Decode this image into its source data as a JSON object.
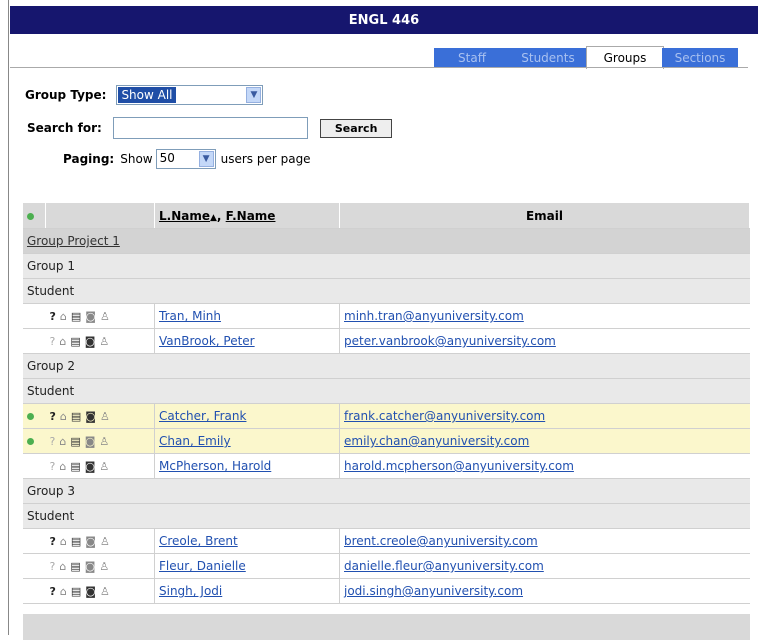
{
  "title": "ENGL 446",
  "tabs": [
    {
      "label": "Staff",
      "active": false
    },
    {
      "label": "Students",
      "active": false
    },
    {
      "label": "Groups",
      "active": true
    },
    {
      "label": "Sections",
      "active": false
    }
  ],
  "form": {
    "group_type_label": "Group Type:",
    "group_type_value": "Show All",
    "search_label": "Search for:",
    "search_value": "",
    "search_button": "Search",
    "paging_label": "Paging:",
    "paging_show": "Show",
    "paging_value": "50",
    "paging_suffix": "users per page"
  },
  "table": {
    "col_name_last": "L.Name",
    "col_sort_indicator": "▲",
    "col_name_sep": ",",
    "col_name_first": "F.Name",
    "col_email": "Email",
    "project": "Group Project 1",
    "groups": [
      {
        "name": "Group 1",
        "role": "Student",
        "members": [
          {
            "name": "Tran, Minh",
            "email": "minh.tran@anyuniversity.com",
            "dot": false,
            "hl": false,
            "q_dark": true,
            "db_dark": false
          },
          {
            "name": "VanBrook, Peter",
            "email": "peter.vanbrook@anyuniversity.com",
            "dot": false,
            "hl": false,
            "q_dark": false,
            "db_dark": true
          }
        ]
      },
      {
        "name": "Group 2",
        "role": "Student",
        "members": [
          {
            "name": "Catcher, Frank",
            "email": "frank.catcher@anyuniversity.com",
            "dot": true,
            "hl": true,
            "q_dark": true,
            "db_dark": true
          },
          {
            "name": "Chan, Emily",
            "email": "emily.chan@anyuniversity.com",
            "dot": true,
            "hl": true,
            "q_dark": false,
            "db_dark": false
          },
          {
            "name": "McPherson, Harold",
            "email": "harold.mcpherson@anyuniversity.com",
            "dot": false,
            "hl": false,
            "q_dark": false,
            "db_dark": true
          }
        ]
      },
      {
        "name": "Group 3",
        "role": "Student",
        "members": [
          {
            "name": "Creole, Brent",
            "email": "brent.creole@anyuniversity.com",
            "dot": false,
            "hl": false,
            "q_dark": true,
            "db_dark": false
          },
          {
            "name": "Fleur, Danielle",
            "email": "danielle.fleur@anyuniversity.com",
            "dot": false,
            "hl": false,
            "q_dark": false,
            "db_dark": false
          },
          {
            "name": "Singh, Jodi",
            "email": "jodi.singh@anyuniversity.com",
            "dot": false,
            "hl": false,
            "q_dark": true,
            "db_dark": true
          }
        ]
      }
    ]
  }
}
